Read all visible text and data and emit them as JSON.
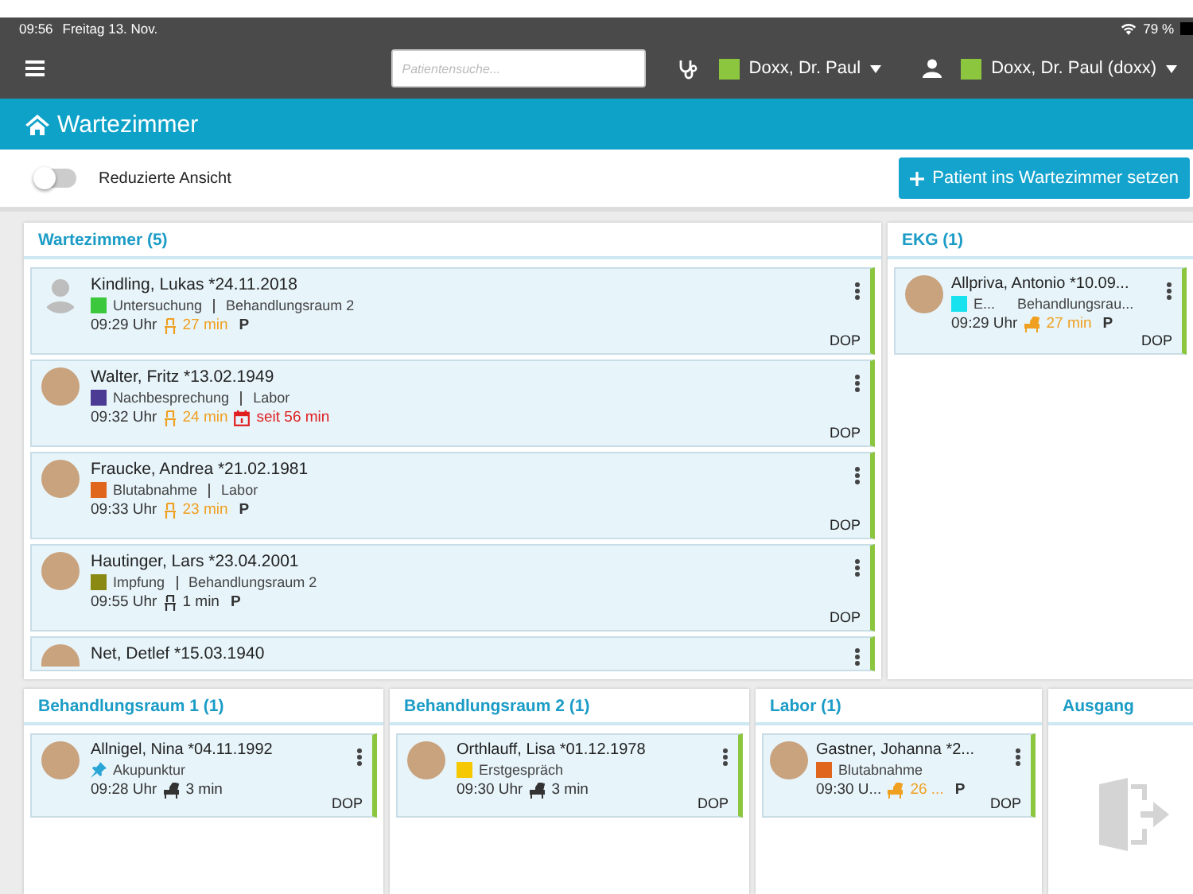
{
  "status_bar": {
    "time": "09:56",
    "date": "Freitag 13. Nov.",
    "battery": "79 %"
  },
  "nav": {
    "search": {
      "placeholder": "Patientensuche..."
    },
    "practitioner": {
      "color": "#8cc63f",
      "name": "Doxx, Dr. Paul"
    },
    "user": {
      "color": "#8cc63f",
      "name": "Doxx, Dr. Paul (doxx)"
    }
  },
  "page_title": "Wartezimmer",
  "toolbar": {
    "toggle": {
      "label": "Reduzierte Ansicht",
      "on": false
    },
    "add_button": "Patient ins Wartezimmer setzen"
  },
  "top_panels": [
    {
      "title": "Wartezimmer (5)",
      "kind": "wide",
      "cards": [
        {
          "name": "Kindling, Lukas *24.11.2018",
          "avatar": {
            "kind": "silhouette"
          },
          "marker": {
            "kind": "color",
            "color": "#3cc83c"
          },
          "category": "Untersuchung",
          "room": "Behandlungsraum 2",
          "time": "09:29 Uhr",
          "wait": {
            "kind": "chair",
            "text": "27 min",
            "alert": true
          },
          "flag": "P",
          "doctor": "DOP"
        },
        {
          "name": "Walter, Fritz *13.02.1949",
          "avatar": {
            "kind": "photo"
          },
          "marker": {
            "kind": "color",
            "color": "#4b3b94"
          },
          "category": "Nachbesprechung",
          "room": "Labor",
          "time": "09:32 Uhr",
          "wait": {
            "kind": "chair",
            "text": "24 min",
            "alert": true
          },
          "overdue": "seit 56 min",
          "doctor": "DOP"
        },
        {
          "name": "Fraucke, Andrea *21.02.1981",
          "avatar": {
            "kind": "photo"
          },
          "marker": {
            "kind": "color",
            "color": "#e0661e"
          },
          "category": "Blutabnahme",
          "room": "Labor",
          "time": "09:33 Uhr",
          "wait": {
            "kind": "chair",
            "text": "23 min",
            "alert": true
          },
          "flag": "P",
          "doctor": "DOP"
        },
        {
          "name": "Hautinger, Lars *23.04.2001",
          "avatar": {
            "kind": "photo"
          },
          "marker": {
            "kind": "color",
            "color": "#8a8a12"
          },
          "category": "Impfung",
          "room": "Behandlungsraum 2",
          "time": "09:55 Uhr",
          "wait": {
            "kind": "chair",
            "text": "1 min",
            "alert": false
          },
          "flag": "P",
          "doctor": "DOP"
        },
        {
          "name": "Net, Detlef *15.03.1940",
          "avatar": {
            "kind": "photo"
          }
        }
      ]
    },
    {
      "title": "EKG (1)",
      "kind": "narrow",
      "cards": [
        {
          "name": "Allpriva, Antonio *10.09...",
          "avatar": {
            "kind": "photo"
          },
          "marker": {
            "kind": "color",
            "color": "#18e2ee"
          },
          "category": "E...",
          "room": "Behandlungsrau...",
          "time": "09:29 Uhr",
          "wait": {
            "kind": "treatment",
            "text": "27 min",
            "alert": true
          },
          "flag": "P",
          "doctor": "DOP"
        }
      ]
    }
  ],
  "bottom_panels": [
    {
      "title": "Behandlungsraum 1 (1)",
      "kind": "room",
      "cards": [
        {
          "name": "Allnigel, Nina *04.11.1992",
          "avatar": {
            "kind": "photo"
          },
          "marker": {
            "kind": "pin"
          },
          "category": "Akupunktur",
          "time": "09:28 Uhr",
          "wait": {
            "kind": "treatment",
            "text": "3 min",
            "alert": false
          },
          "doctor": "DOP"
        }
      ]
    },
    {
      "title": "Behandlungsraum 2 (1)",
      "kind": "room",
      "cards": [
        {
          "name": "Orthlauff, Lisa *01.12.1978",
          "avatar": {
            "kind": "photo"
          },
          "marker": {
            "kind": "color",
            "color": "#f5c800"
          },
          "category": "Erstgespräch",
          "time": "09:30 Uhr",
          "wait": {
            "kind": "treatment",
            "text": "3 min",
            "alert": false
          },
          "doctor": "DOP"
        }
      ]
    },
    {
      "title": "Labor (1)",
      "kind": "room",
      "cards": [
        {
          "name": "Gastner, Johanna *2...",
          "avatar": {
            "kind": "photo"
          },
          "marker": {
            "kind": "color",
            "color": "#e0661e"
          },
          "category": "Blutabnahme",
          "time": "09:30 U...",
          "wait": {
            "kind": "treatment",
            "text": "26 ...",
            "alert": true
          },
          "flag": "P",
          "doctor": "DOP"
        }
      ]
    },
    {
      "title": "Ausgang",
      "kind": "exit"
    }
  ]
}
